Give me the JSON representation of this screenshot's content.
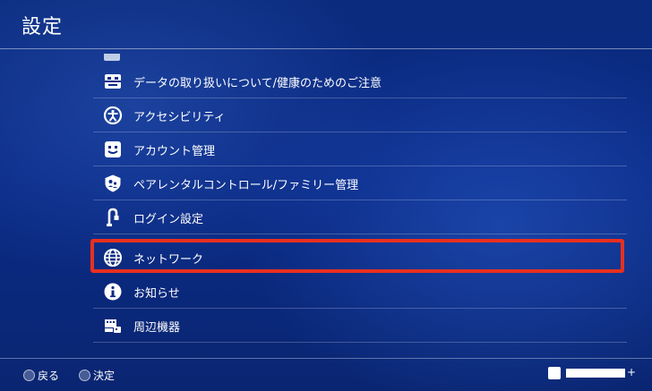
{
  "header": {
    "title": "設定"
  },
  "menu": {
    "partial_item": "■ ■■■■■■■■■■■■■■■",
    "items": [
      {
        "label": "データの取り扱いについて/健康のためのご注意",
        "icon": "health-safety-icon"
      },
      {
        "label": "アクセシビリティ",
        "icon": "accessibility-icon"
      },
      {
        "label": "アカウント管理",
        "icon": "account-icon"
      },
      {
        "label": "ペアレンタルコントロール/ファミリー管理",
        "icon": "parental-control-icon"
      },
      {
        "label": "ログイン設定",
        "icon": "login-icon"
      },
      {
        "label": "ネットワーク",
        "icon": "globe-icon",
        "selected": true
      },
      {
        "label": "お知らせ",
        "icon": "info-icon"
      },
      {
        "label": "周辺機器",
        "icon": "devices-icon"
      }
    ]
  },
  "footer": {
    "back_label": "戻る",
    "confirm_label": "決定",
    "plus_symbol": "+"
  },
  "colors": {
    "background": "#0a2a86",
    "highlight": "#e8301f",
    "text": "#ffffff"
  }
}
